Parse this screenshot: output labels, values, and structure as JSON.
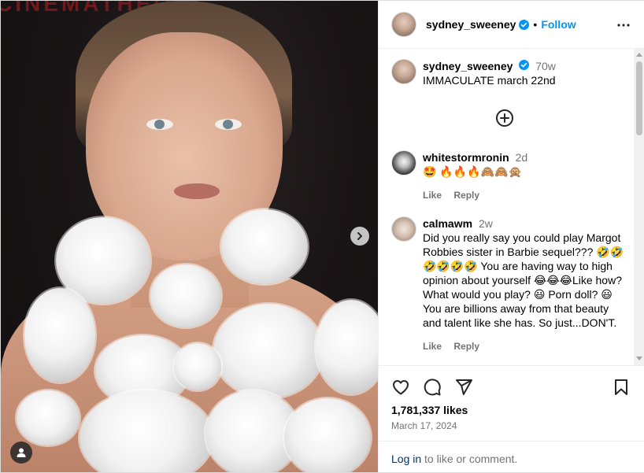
{
  "media": {
    "background_text": "CINEMATHEQUE",
    "next_icon": "chevron-right-icon",
    "tag_icon": "user-tag-icon"
  },
  "header": {
    "username": "sydney_sweeney",
    "separator": "•",
    "follow_label": "Follow",
    "more_icon": "more-horizontal-icon"
  },
  "caption": {
    "username": "sydney_sweeney",
    "age": "70w",
    "text": "IMMACULATE march 22nd"
  },
  "load_more_icon": "plus-circle-icon",
  "comments": [
    {
      "username": "whitestormronin",
      "age": "2d",
      "text": "🤩 🔥🔥🔥🙈🙈🙊",
      "like_label": "Like",
      "reply_label": "Reply"
    },
    {
      "username": "calmawm",
      "age": "2w",
      "text": "Did you really say you could play Margot Robbies sister in Barbie sequel??? 🤣🤣🤣🤣🤣🤣 You are having way to high opinion about yourself 😂😂😂Like how? What would you play? 😃 Porn doll? 😃 You are billions away from that beauty and talent like she has. So just...DON'T.",
      "like_label": "Like",
      "reply_label": "Reply"
    }
  ],
  "actions": {
    "like_icon": "heart-icon",
    "comment_icon": "comment-icon",
    "share_icon": "share-icon",
    "save_icon": "bookmark-icon"
  },
  "likes": "1,781,337 likes",
  "date": "March 17, 2024",
  "login": {
    "link_text": "Log in",
    "rest_text": " to like or comment."
  },
  "colors": {
    "accent": "#0095f6",
    "verified": "#0095f6",
    "muted": "#737373"
  }
}
